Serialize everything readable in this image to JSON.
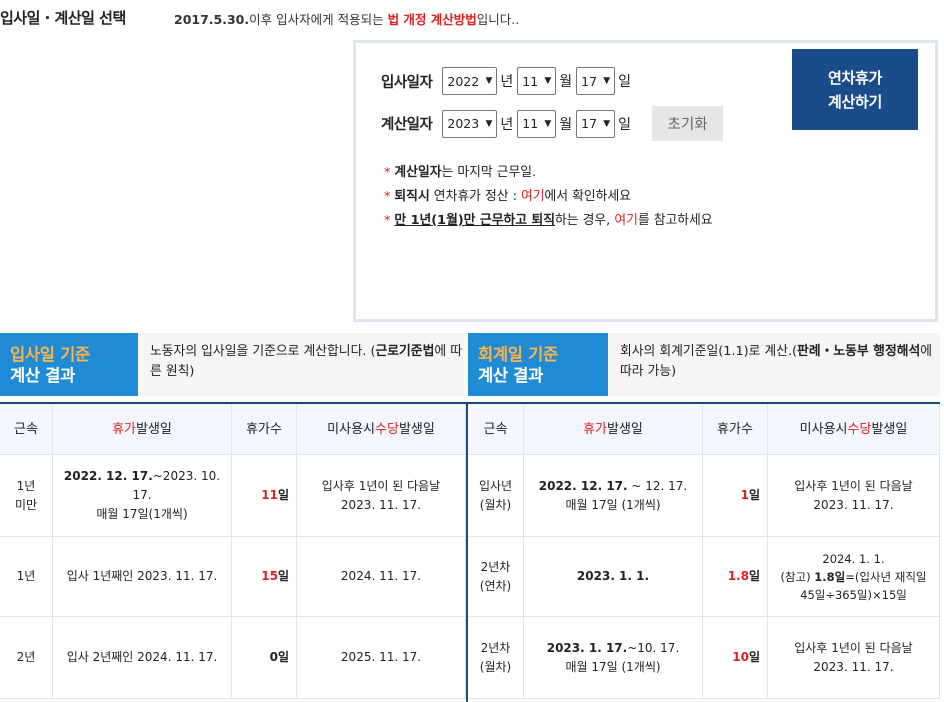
{
  "header": {
    "title": "입사일 · 계산일 선택",
    "notice_date": "2017.5.30.",
    "notice_mid": "이후 입사자에게 적용되는 ",
    "notice_red": "법 개정 계산방법",
    "notice_end": "입니다.."
  },
  "form": {
    "join_label": "입사일자",
    "calc_label": "계산일자",
    "join_year": "2022",
    "join_month": "11",
    "join_day": "17",
    "calc_year": "2023",
    "calc_month": "11",
    "calc_day": "17",
    "unit_year": "년",
    "unit_month": "월",
    "unit_day": "일",
    "reset_label": "초기화",
    "calc_button_line1": "연차휴가",
    "calc_button_line2": "계산하기"
  },
  "notes": {
    "n1_bold": "계산일자",
    "n1_rest": "는 마지막 근무일.",
    "n2_bold": "퇴직시",
    "n2_mid": " 연차휴가 정산 : ",
    "n2_red": "여기",
    "n2_end": "에서 확인하세요",
    "n3_bold": "만 1년(1월)만 근무하고 퇴직",
    "n3_mid": "하는 경우, ",
    "n3_red": "여기",
    "n3_end": "를 참고하세요"
  },
  "section_left": {
    "title_orange": "입사일 기준",
    "title_white": "계산 결과",
    "desc_pre": "노동자의 입사일을 기준으로 계산합니다. (",
    "desc_bold": "근로기준법",
    "desc_post": "에 따른 원칙)"
  },
  "section_right": {
    "title_orange": "회계일 기준",
    "title_white": "계산 결과",
    "desc_pre": "회사의 회계기준일(1.1)로 계산.(",
    "desc_bold": "판례・노동부 행정해석",
    "desc_post": "에 따라 가능)"
  },
  "table_headers": {
    "tenure": "근속",
    "leave_red": "휴가",
    "leave_rest": " 발생일",
    "count": "휴가수",
    "allow_pre": "미사용시 ",
    "allow_red": "수당",
    "allow_post": " 발생일"
  },
  "left_rows": [
    {
      "tenure": "1년 미만",
      "leave_bold": "2022. 12. 17.",
      "leave_rest": "~2023. 10. 17.",
      "leave_line2": "매월 17일(1개씩)",
      "count_num": "11",
      "count_unit": "일",
      "allow_line1": "입사후 1년이 된 다음날",
      "allow_line2": "2023. 11. 17."
    },
    {
      "tenure": "1년",
      "leave_plain": "입사 1년째인 2023. 11. 17.",
      "count_num": "15",
      "count_unit": "일",
      "allow_line1": "2024. 11. 17."
    },
    {
      "tenure": "2년",
      "leave_plain": "입사 2년째인 2024. 11. 17.",
      "count_num": "0",
      "count_unit": "일",
      "allow_line1": "2025. 11. 17."
    }
  ],
  "right_rows": [
    {
      "tenure_line1": "입사년",
      "tenure_line2": "(월차)",
      "leave_bold": "2022. 12. 17.",
      "leave_rest": " ~ 12. 17.",
      "leave_line2": "매월 17일 (1개씩)",
      "count_num": "1",
      "count_unit": "일",
      "allow_line1": "입사후 1년이 된 다음날",
      "allow_line2": "2023. 11. 17."
    },
    {
      "tenure_line1": "2년차",
      "tenure_line2": "(연차)",
      "leave_bold": "2023. 1. 1.",
      "count_num": "1.8",
      "count_unit": "일",
      "allow_line1": "2024. 1. 1.",
      "allow_line2_pre": "(참고) ",
      "allow_line2_bold": "1.8일",
      "allow_line2_post": "=(입사년 재직일",
      "allow_line3": "45일÷365일)×15일"
    },
    {
      "tenure_line1": "2년차",
      "tenure_line2": "(월차)",
      "leave_bold": "2023. 1. 17.",
      "leave_rest": "~10. 17.",
      "leave_line2": "매월 17일 (1개씩)",
      "count_num": "10",
      "count_unit": "일",
      "allow_line1": "입사후 1년이 된 다음날",
      "allow_line2": "2023. 11. 17."
    }
  ],
  "colors": {
    "accent_red": "#e02020",
    "header_blue": "#1f8bd4",
    "button_navy": "#1a4b8b",
    "title_orange": "#ffb347"
  }
}
